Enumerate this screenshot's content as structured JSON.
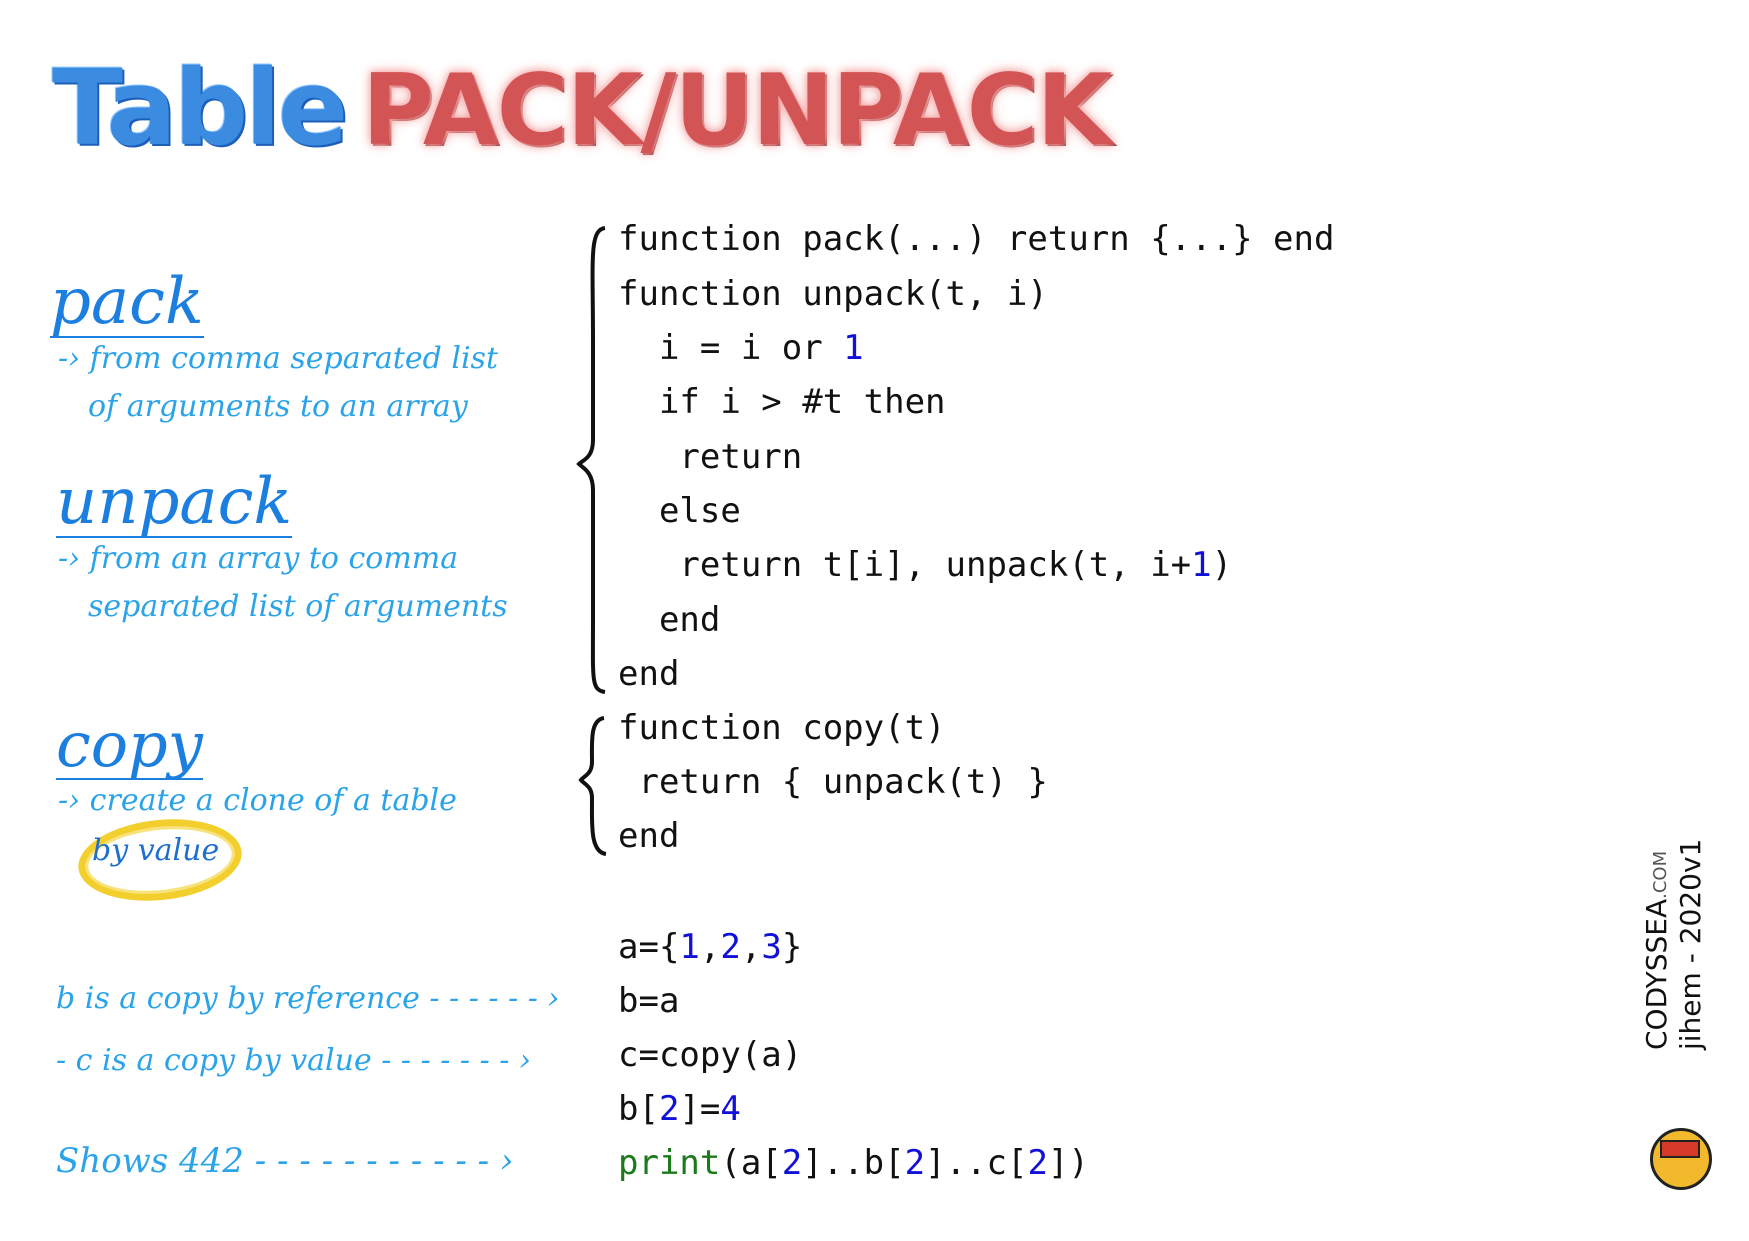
{
  "title": {
    "word1": "Table",
    "word2": "PACK/UNPACK"
  },
  "notes": {
    "pack": {
      "heading": "pack",
      "line1": "-› from comma separated list",
      "line2": "of arguments to an array"
    },
    "unpack": {
      "heading": "unpack",
      "line1": "-› from an array to comma",
      "line2": "separated list of arguments"
    },
    "copy": {
      "heading": "copy",
      "line1": "-› create a clone of a table",
      "line2": "by value"
    }
  },
  "code": {
    "pack_line": "function pack(...) return {...} end",
    "unpack": [
      "function unpack(t, i)",
      "  i = i or ",
      "  if i > #t then",
      "   return",
      "  else",
      "   return t[i], unpack(t, i+",
      "  end",
      "end"
    ],
    "nums": {
      "one": "1"
    },
    "copy": [
      "function copy(t)",
      " return { unpack(t) }",
      "end"
    ],
    "example": {
      "a_prefix": "a={",
      "a1": "1",
      "c1": ",",
      "a2": "2",
      "c2": ",",
      "a3": "3",
      "a_suffix": "}",
      "b": "b=a",
      "c": "c=copy(a)",
      "d_prefix": "b[",
      "d_idx": "2",
      "d_mid": "]=",
      "d_val": "4",
      "print_kw": "print",
      "p1": "(a[",
      "p2": "2",
      "p3": "]..b[",
      "p4": "2",
      "p5": "]..c[",
      "p6": "2",
      "p7": "])"
    }
  },
  "annotations": {
    "b_ref": "b is a copy by reference - - - - - - ›",
    "c_val": "- c is a copy by value - - - - - - -  ›",
    "shows": "Shows  442  - - - - - - - - - - - ›"
  },
  "logo": {
    "brand": "CODYSSEA",
    "domain": ".COM",
    "author": "jihem - 2020v1"
  }
}
